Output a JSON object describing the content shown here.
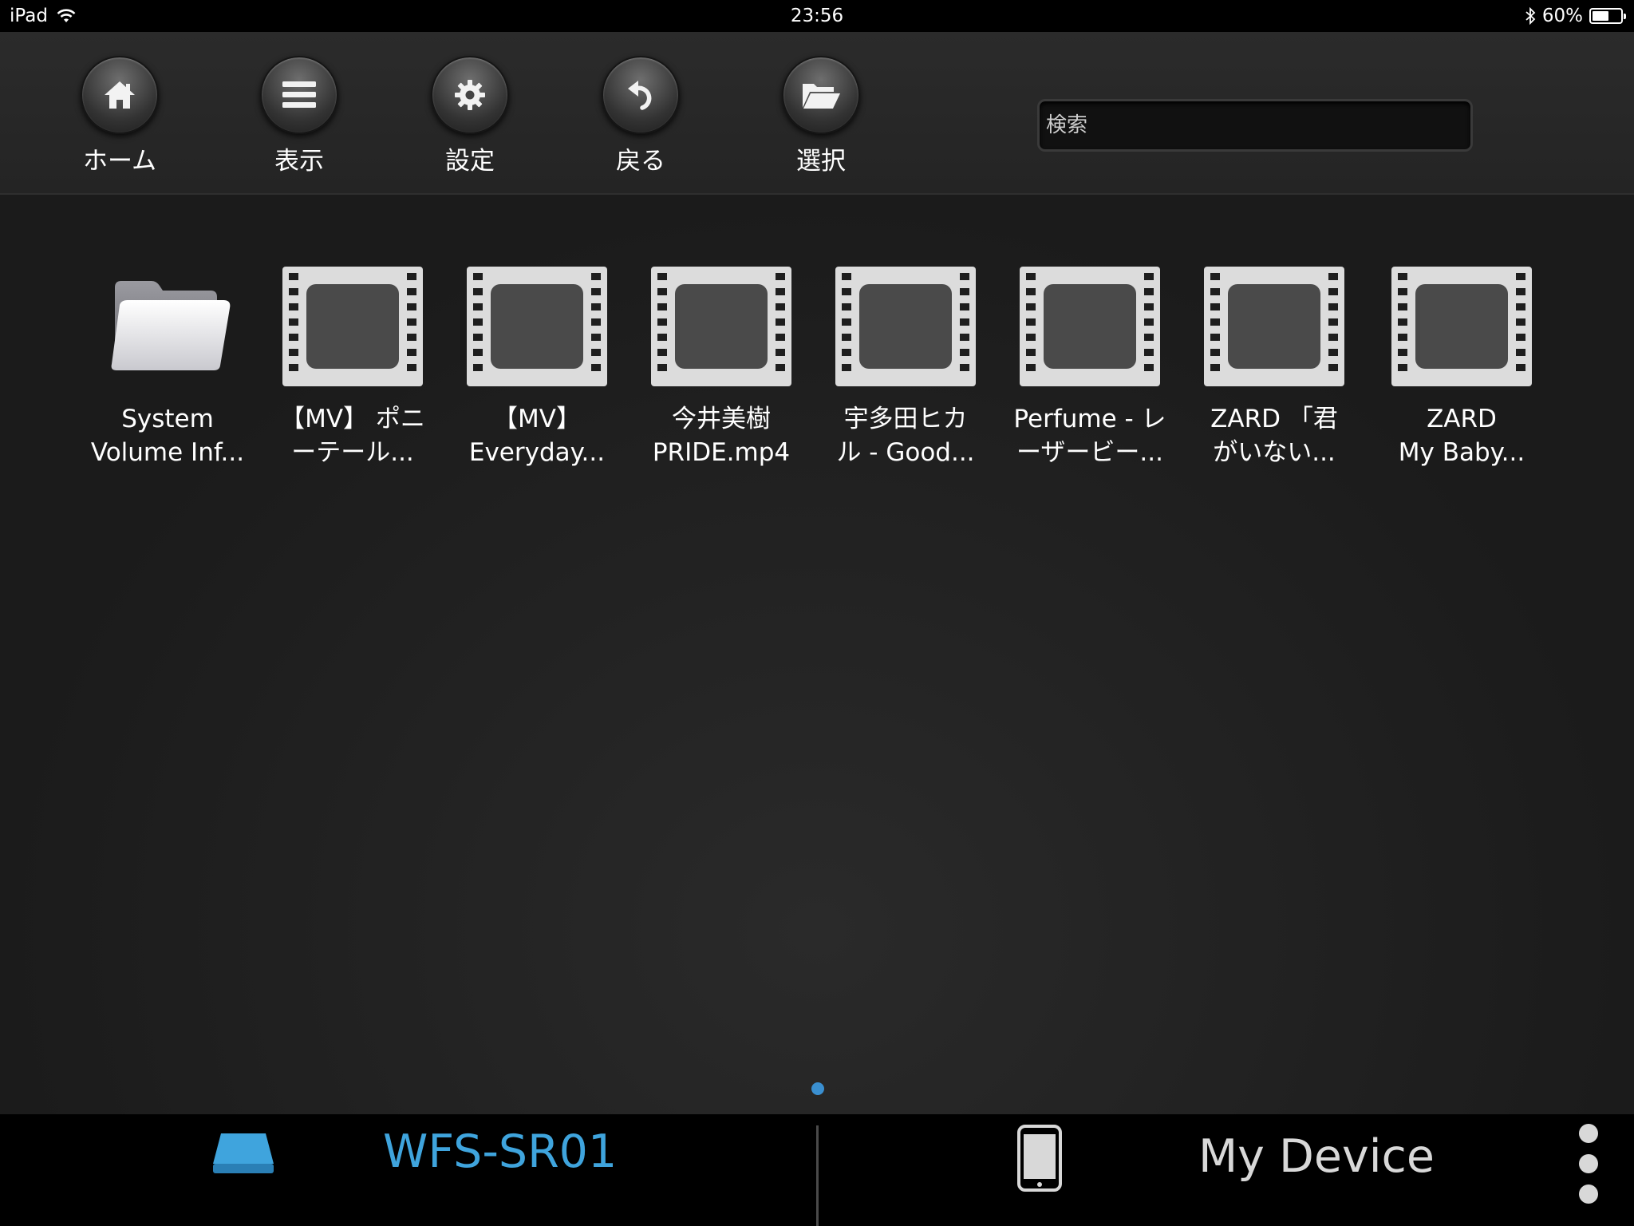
{
  "status_bar": {
    "device": "iPad",
    "time": "23:56",
    "battery_percent": "60%",
    "battery_level": 0.6,
    "icons": [
      "wifi-icon",
      "bluetooth-icon",
      "battery-icon"
    ]
  },
  "toolbar": {
    "buttons": [
      {
        "label": "ホーム",
        "icon": "home-icon"
      },
      {
        "label": "表示",
        "icon": "list-icon"
      },
      {
        "label": "設定",
        "icon": "gear-icon"
      },
      {
        "label": "戻る",
        "icon": "back-arrow-icon"
      },
      {
        "label": "選択",
        "icon": "open-folder-icon"
      }
    ],
    "search": {
      "placeholder": "検索",
      "value": ""
    }
  },
  "files": [
    {
      "name": "System\nVolume Inf...",
      "type": "folder"
    },
    {
      "name": "【MV】 ポニ\nーテール...",
      "type": "video"
    },
    {
      "name": "【MV】\nEveryday...",
      "type": "video"
    },
    {
      "name": "今井美樹\nPRIDE.mp4",
      "type": "video"
    },
    {
      "name": "宇多田ヒカ\nル - Good...",
      "type": "video"
    },
    {
      "name": "Perfume - レ\nーザービー...",
      "type": "video"
    },
    {
      "name": "ZARD 「君\nがいない...",
      "type": "video"
    },
    {
      "name": "ZARD\nMy Baby...",
      "type": "video"
    }
  ],
  "pager": {
    "current_page": 1,
    "total_pages": 1
  },
  "bottom_bar": {
    "left": {
      "label": "WFS-SR01",
      "icon": "drive-icon",
      "color": "#3fa4dd"
    },
    "right": {
      "label": "My Device",
      "icon": "phone-icon",
      "color": "#d8d8d8"
    },
    "more_icon": "more-vertical-icon"
  }
}
